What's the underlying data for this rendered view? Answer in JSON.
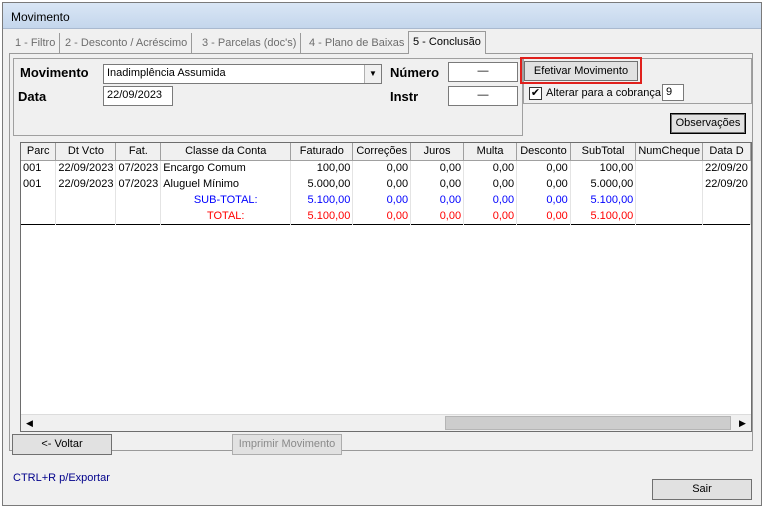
{
  "window": {
    "title": "Movimento"
  },
  "tabs": [
    "1 - Filtro",
    "2 - Desconto / Acréscimo",
    "3 - Parcelas (doc's)",
    "4 - Plano de Baixas",
    "5 - Conclusão"
  ],
  "form": {
    "movimento_label": "Movimento",
    "movimento_value": "Inadimplência Assumida",
    "data_label": "Data",
    "data_value": "22/09/2023",
    "numero_label": "Número",
    "numero_value": "—",
    "instr_label": "Instr",
    "instr_value": "—",
    "efetivar_label": "Efetivar Movimento",
    "alterar_label": "Alterar para a cobrança",
    "alterar_checked": true,
    "alterar_value": "9",
    "observacoes_label": "Observações"
  },
  "grid": {
    "columns": [
      "Parc",
      "Dt Vcto",
      "Fat.",
      "Classe da Conta",
      "Faturado",
      "Correções",
      "Juros",
      "Multa",
      "Desconto",
      "SubTotal",
      "NumCheque",
      "Data D"
    ],
    "rows": [
      [
        "001",
        "22/09/2023",
        "07/2023",
        "Encargo Comum",
        "100,00",
        "0,00",
        "0,00",
        "0,00",
        "0,00",
        "100,00",
        "",
        "22/09/20"
      ],
      [
        "001",
        "22/09/2023",
        "07/2023",
        "Aluguel Mínimo",
        "5.000,00",
        "0,00",
        "0,00",
        "0,00",
        "0,00",
        "5.000,00",
        "",
        "22/09/20"
      ]
    ],
    "subtotal": [
      "SUB-TOTAL:",
      "5.100,00",
      "0,00",
      "0,00",
      "0,00",
      "0,00",
      "5.100,00"
    ],
    "total": [
      "TOTAL:",
      "5.100,00",
      "0,00",
      "0,00",
      "0,00",
      "0,00",
      "5.100,00"
    ],
    "subtotal_color": "#0000ff",
    "total_color": "#ff0000"
  },
  "footer": {
    "voltar_label": "<- Voltar",
    "imprimir_label": "Imprimir Movimento",
    "export_hint": "CTRL+R p/Exportar",
    "sair_label": "Sair"
  },
  "highlight_color": "#e0201c"
}
